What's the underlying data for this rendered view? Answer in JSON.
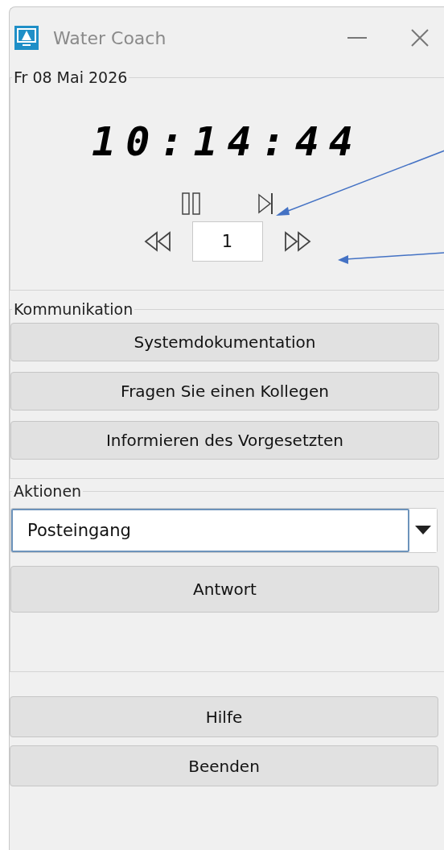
{
  "window": {
    "title": "Water Coach"
  },
  "date_group": {
    "title": "Fr 08 Mai 2026",
    "clock": "10:14:44",
    "step_value": "1"
  },
  "communication_group": {
    "title": "Kommunikation",
    "buttons": [
      "Systemdokumentation",
      "Fragen Sie einen Kollegen",
      "Informieren des Vorgesetzten"
    ]
  },
  "actions_group": {
    "title": "Aktionen",
    "dropdown": {
      "value": "Posteingang"
    },
    "buttons": [
      "Antwort"
    ]
  },
  "footer_buttons": [
    "Hilfe",
    "Beenden"
  ]
}
